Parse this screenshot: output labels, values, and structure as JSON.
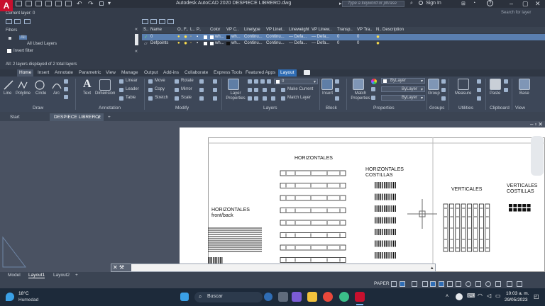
{
  "window": {
    "title": "Autodesk AutoCAD 2020    DESPIECE LIBRERO.dwg",
    "search_placeholder": "Type a keyword or phrase",
    "signin": "Sign In"
  },
  "layer_palette": {
    "current_layer": "Current layer: 0",
    "search_layer": "Search for layer",
    "filters_title": "Filters",
    "tree": [
      "All",
      "All Used Layers"
    ],
    "invert_filter": "Invert filter",
    "columns": [
      "S..",
      "Name",
      "O..",
      "F..",
      "L..",
      "P..",
      "Color",
      "VP C..",
      "Linetype",
      "VP Linet..",
      "Lineweight",
      "VP Linew..",
      "Transp..",
      "VP Tra..",
      "N..",
      "Description"
    ],
    "rows": [
      {
        "name": "0",
        "color": "wh...",
        "vp_color": "wh...",
        "linetype": "Continu...",
        "vp_linetype": "Continu...",
        "lineweight": "— Defa...",
        "vp_lineweight": "— Defa...",
        "transparency": "0",
        "vp_transparency": "0"
      },
      {
        "name": "Defpoints",
        "color": "wh...",
        "vp_color": "wh...",
        "linetype": "Continu...",
        "vp_linetype": "Continu...",
        "lineweight": "— Defa...",
        "vp_lineweight": "— Defa...",
        "transparency": "0",
        "vp_transparency": "0"
      }
    ],
    "status": "All: 2 layers displayed of 2 total layers"
  },
  "ribbon_tabs": [
    "Home",
    "Insert",
    "Annotate",
    "Parametric",
    "View",
    "Manage",
    "Output",
    "Add-ins",
    "Collaborate",
    "Express Tools",
    "Featured Apps",
    "Layout"
  ],
  "ribbon": {
    "draw": {
      "title": "Draw",
      "tools": [
        "Line",
        "Polyline",
        "Circle",
        "Arc"
      ]
    },
    "annotation": {
      "title": "Annotation",
      "tools": [
        "Text",
        "Dimension",
        "Linear",
        "Leader",
        "Table"
      ]
    },
    "modify": {
      "title": "Modify",
      "tools": [
        "Move",
        "Rotate",
        "Copy",
        "Mirror",
        "Stretch",
        "Scale"
      ]
    },
    "layers": {
      "title": "Layers",
      "tools": [
        "Layer Properties",
        "Make Current",
        "Match Layer"
      ],
      "current": "0"
    },
    "block": {
      "title": "Block",
      "tools": [
        "Insert"
      ]
    },
    "properties": {
      "title": "Properties",
      "tools": [
        "Match Properties"
      ],
      "combos": [
        "ByLayer",
        "ByLayer",
        "ByLayer"
      ]
    },
    "groups": {
      "title": "Groups",
      "tools": [
        "Group"
      ]
    },
    "utilities": {
      "title": "Utilities",
      "tools": [
        "Measure"
      ]
    },
    "clipboard": {
      "title": "Clipboard",
      "tools": [
        "Paste"
      ]
    },
    "view": {
      "title": "View",
      "tools": [
        "Base"
      ]
    }
  },
  "doc_tabs": [
    "Start",
    "DESPIECE LIBRERO*"
  ],
  "drawing": {
    "labels": [
      "HORIZONTALES",
      "HORIZONTALES COSTILLAS",
      "VERTICALES",
      "VERTICALES COSTILLAS",
      "HORIZONTALES front/back"
    ]
  },
  "command_line": {
    "placeholder": ""
  },
  "layout_tabs": [
    "Model",
    "Layout1",
    "Layout2"
  ],
  "status": {
    "paper": "PAPER"
  },
  "taskbar": {
    "weather_temp": "18°C",
    "weather_desc": "Humedad",
    "search": "Buscar",
    "time": "10:03 a. m.",
    "date": "29/05/2023"
  },
  "colors": {
    "accent": "#2f6db5",
    "autocad_red": "#c8102e"
  }
}
